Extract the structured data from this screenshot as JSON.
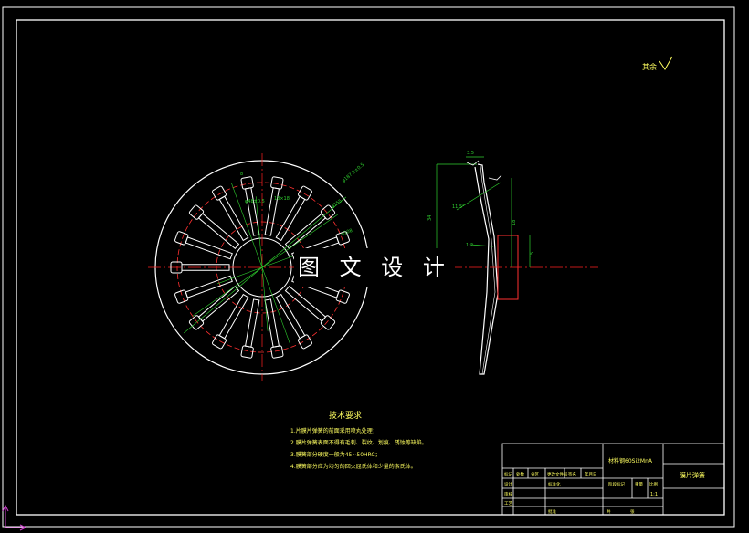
{
  "watermark": "图 文 设 计",
  "roughness_note": "其余",
  "tech_requirements": {
    "title": "技术要求",
    "items": [
      "1.片膜片弹簧的前面采用喷丸处理；",
      "2.膜片弹簧表面不得有毛刺、裂纹、划痕、锈蚀等缺陷。",
      "3.膜簧部分硬度一般为45~50HRC；",
      "4.膜簧部分应为均匀的回火屈氏体和少量的索氏体。"
    ]
  },
  "title_block": {
    "material": "材料钢60Si2MnA",
    "part_name": "膜片弹簧",
    "row_labels": [
      "标记",
      "处数",
      "分区",
      "更改文件号",
      "签名",
      "年月日"
    ],
    "design_label": "设计",
    "std_label": "标准化",
    "review_label": "审核",
    "process_label": "工艺",
    "approve_label": "批准",
    "stage_label": "阶段标记",
    "weight_label": "重量",
    "scale_label": "比例",
    "scale_value": "1:1",
    "sheet_label": "共",
    "sheet_label2": "张"
  },
  "dimensions": {
    "d1": "3.5",
    "d2": "2",
    "d3": "11.5°",
    "d4": "34",
    "d5": "18",
    "d6": "1:2",
    "d7": "15",
    "r1": "φ187.3±0.5",
    "r2": "φ155",
    "r3": "φ108",
    "r4": "φ48±0.5",
    "r5": "18×18",
    "r6": "8"
  },
  "colors": {
    "frame": "#ffffff",
    "part": "#ffffff",
    "center": "#ff2020",
    "dim": "#2fd12f",
    "hidden": "#ff3030",
    "text": "#ffff60"
  }
}
